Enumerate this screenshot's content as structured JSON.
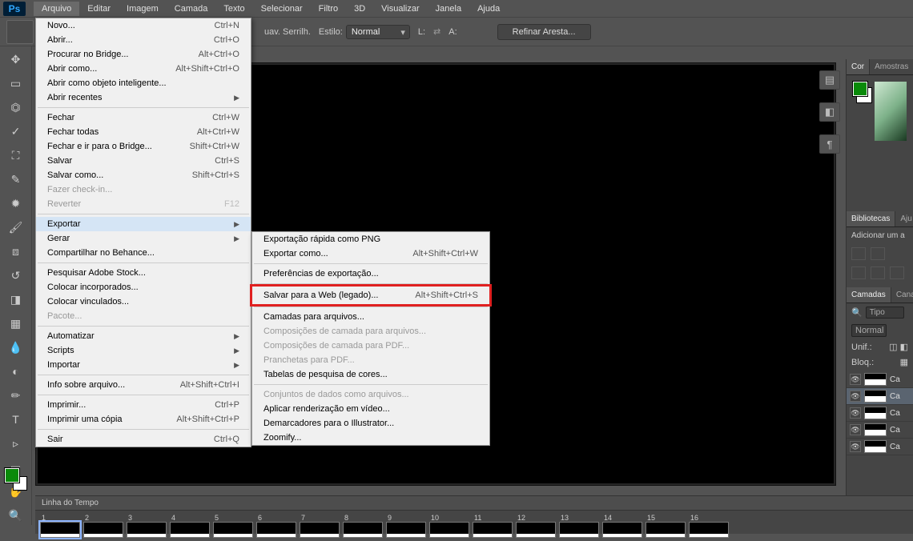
{
  "menubar": {
    "items": [
      "Arquivo",
      "Editar",
      "Imagem",
      "Camada",
      "Texto",
      "Selecionar",
      "Filtro",
      "3D",
      "Visualizar",
      "Janela",
      "Ajuda"
    ],
    "active_index": 0
  },
  "options_bar": {
    "suavizar": "uav. Serrilh.",
    "estilo_label": "Estilo:",
    "estilo_value": "Normal",
    "L_label": "L:",
    "A_label": "A:",
    "refine_btn": "Refinar Aresta..."
  },
  "file_menu": [
    {
      "label": "Novo...",
      "shortcut": "Ctrl+N"
    },
    {
      "label": "Abrir...",
      "shortcut": "Ctrl+O"
    },
    {
      "label": "Procurar no Bridge...",
      "shortcut": "Alt+Ctrl+O"
    },
    {
      "label": "Abrir como...",
      "shortcut": "Alt+Shift+Ctrl+O"
    },
    {
      "label": "Abrir como objeto inteligente..."
    },
    {
      "label": "Abrir recentes",
      "submenu": true
    },
    {
      "sep": true
    },
    {
      "label": "Fechar",
      "shortcut": "Ctrl+W"
    },
    {
      "label": "Fechar todas",
      "shortcut": "Alt+Ctrl+W"
    },
    {
      "label": "Fechar e ir para o Bridge...",
      "shortcut": "Shift+Ctrl+W"
    },
    {
      "label": "Salvar",
      "shortcut": "Ctrl+S"
    },
    {
      "label": "Salvar como...",
      "shortcut": "Shift+Ctrl+S"
    },
    {
      "label": "Fazer check-in...",
      "disabled": true
    },
    {
      "label": "Reverter",
      "shortcut": "F12",
      "disabled": true
    },
    {
      "sep": true
    },
    {
      "label": "Exportar",
      "submenu": true,
      "highlighted": true
    },
    {
      "label": "Gerar",
      "submenu": true
    },
    {
      "label": "Compartilhar no Behance..."
    },
    {
      "sep": true
    },
    {
      "label": "Pesquisar Adobe Stock..."
    },
    {
      "label": "Colocar incorporados..."
    },
    {
      "label": "Colocar vinculados..."
    },
    {
      "label": "Pacote...",
      "disabled": true
    },
    {
      "sep": true
    },
    {
      "label": "Automatizar",
      "submenu": true
    },
    {
      "label": "Scripts",
      "submenu": true
    },
    {
      "label": "Importar",
      "submenu": true
    },
    {
      "sep": true
    },
    {
      "label": "Info sobre arquivo...",
      "shortcut": "Alt+Shift+Ctrl+I"
    },
    {
      "sep": true
    },
    {
      "label": "Imprimir...",
      "shortcut": "Ctrl+P"
    },
    {
      "label": "Imprimir uma cópia",
      "shortcut": "Alt+Shift+Ctrl+P"
    },
    {
      "sep": true
    },
    {
      "label": "Sair",
      "shortcut": "Ctrl+Q"
    }
  ],
  "export_submenu": [
    {
      "label": "Exportação rápida como PNG"
    },
    {
      "label": "Exportar como...",
      "shortcut": "Alt+Shift+Ctrl+W"
    },
    {
      "sep": true
    },
    {
      "label": "Preferências de exportação..."
    },
    {
      "sep": true
    },
    {
      "label": "Salvar para a Web (legado)...",
      "shortcut": "Alt+Shift+Ctrl+S",
      "redbox": true
    },
    {
      "sep": true
    },
    {
      "label": "Camadas para arquivos..."
    },
    {
      "label": "Composições de camada para arquivos...",
      "disabled": true
    },
    {
      "label": "Composições de camada para PDF...",
      "disabled": true
    },
    {
      "label": "Pranchetas para PDF...",
      "disabled": true
    },
    {
      "label": "Tabelas de pesquisa de cores..."
    },
    {
      "sep": true
    },
    {
      "label": "Conjuntos de dados como arquivos...",
      "disabled": true
    },
    {
      "label": "Aplicar renderização em vídeo..."
    },
    {
      "label": "Demarcadores para o Illustrator..."
    },
    {
      "label": "Zoomify..."
    }
  ],
  "right_panels": {
    "color_tab": "Cor",
    "swatches_tab": "Amostras",
    "libraries_tab": "Bibliotecas",
    "adjustments_tab": "Aju",
    "add_adjustment": "Adicionar um a",
    "layers_tab": "Camadas",
    "channels_tab": "Cana",
    "search_label": "Tipo",
    "blend_mode": "Normal",
    "unif_label": "Unif.:",
    "bloq_label": "Bloq.:",
    "layers": [
      "Ca",
      "Ca",
      "Ca",
      "Ca",
      "Ca"
    ]
  },
  "timeline": {
    "title": "Linha do Tempo",
    "frames": [
      "1",
      "2",
      "3",
      "4",
      "5",
      "6",
      "7",
      "8",
      "9",
      "10",
      "11",
      "12",
      "13",
      "14",
      "15",
      "16"
    ]
  },
  "colors": {
    "fg": "#0a8a0a",
    "bg": "#ffffff"
  },
  "tools": [
    "↖",
    "▭",
    "◫",
    "✎",
    "✂",
    "✐",
    "⌁",
    "◉",
    "✦",
    "✎",
    "◧",
    "▲",
    "●",
    "✎",
    "T",
    "▷",
    "✋",
    "🔍"
  ]
}
